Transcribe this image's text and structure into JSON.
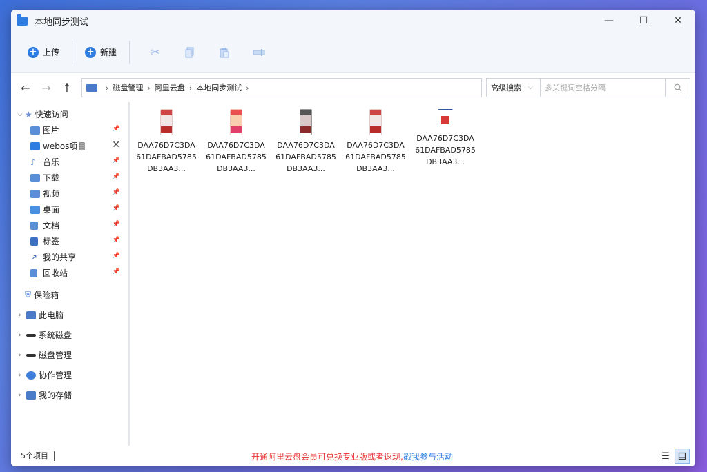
{
  "window": {
    "title": "本地同步测试"
  },
  "toolbar": {
    "upload_label": "上传",
    "new_label": "新建"
  },
  "breadcrumb": {
    "items": [
      "磁盘管理",
      "阿里云盘",
      "本地同步测试"
    ]
  },
  "search": {
    "mode": "高级搜索",
    "placeholder": "多关键词空格分隔"
  },
  "sidebar": {
    "quick_access": "快速访问",
    "quick_items": [
      {
        "label": "图片",
        "icon": "image-icon"
      },
      {
        "label": "webos项目",
        "icon": "folder-icon"
      },
      {
        "label": "音乐",
        "icon": "music-icon"
      },
      {
        "label": "下载",
        "icon": "download-icon"
      },
      {
        "label": "视频",
        "icon": "video-icon"
      },
      {
        "label": "桌面",
        "icon": "desktop-icon"
      },
      {
        "label": "文档",
        "icon": "document-icon"
      },
      {
        "label": "标签",
        "icon": "tag-icon"
      },
      {
        "label": "我的共享",
        "icon": "share-icon"
      },
      {
        "label": "回收站",
        "icon": "trash-icon"
      }
    ],
    "vault": "保险箱",
    "groups": [
      {
        "label": "此电脑",
        "icon": "computer-icon"
      },
      {
        "label": "系统磁盘",
        "icon": "disk-icon"
      },
      {
        "label": "磁盘管理",
        "icon": "disk-manage-icon"
      },
      {
        "label": "协作管理",
        "icon": "collab-icon"
      },
      {
        "label": "我的存储",
        "icon": "storage-icon"
      }
    ]
  },
  "files": [
    {
      "name": "DAA76D7C3DA61DAFBAD5785DB3AA3..."
    },
    {
      "name": "DAA76D7C3DA61DAFBAD5785DB3AA3..."
    },
    {
      "name": "DAA76D7C3DA61DAFBAD5785DB3AA3..."
    },
    {
      "name": "DAA76D7C3DA61DAFBAD5785DB3AA3..."
    },
    {
      "name": "DAA76D7C3DA61DAFBAD5785DB3AA3..."
    }
  ],
  "status": {
    "count": "5个项目",
    "promo_text": "开通阿里云盘会员可兑换专业版或者返现,",
    "promo_link": "戳我参与活动"
  },
  "colors": {
    "accent": "#2f7de1",
    "promo_red": "#e63030"
  }
}
